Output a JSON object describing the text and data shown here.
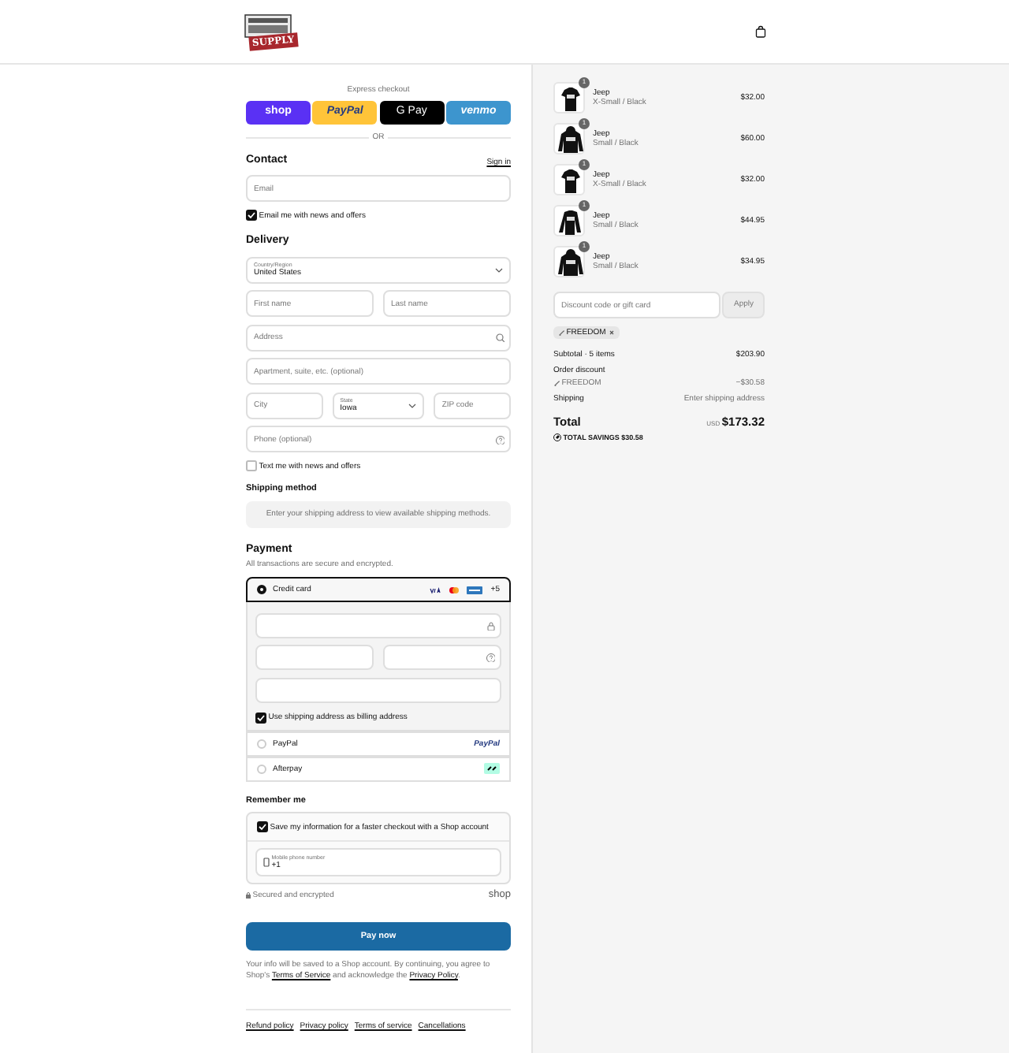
{
  "header": {
    "logo_text": "SUPPLY"
  },
  "express": {
    "title": "Express checkout",
    "buttons": [
      {
        "label": "shop",
        "kind": "shop"
      },
      {
        "label": "PayPal",
        "kind": "paypal"
      },
      {
        "label": "G Pay",
        "kind": "gpay"
      },
      {
        "label": "venmo",
        "kind": "venmo"
      }
    ],
    "separator": "OR"
  },
  "contact": {
    "heading": "Contact",
    "sign_in": "Sign in",
    "email": {
      "placeholder": "Email"
    },
    "news": {
      "label": "Email me with news and offers",
      "checked": true
    }
  },
  "delivery": {
    "heading": "Delivery",
    "rows": [
      [
        {
          "kind": "select",
          "label": "Country/Region",
          "value": "United States"
        }
      ],
      [
        {
          "kind": "text",
          "placeholder": "First name"
        },
        {
          "kind": "text",
          "placeholder": "Last name"
        }
      ],
      [
        {
          "kind": "search",
          "placeholder": "Address"
        }
      ],
      [
        {
          "kind": "text",
          "placeholder": "Apartment, suite, etc. (optional)"
        }
      ],
      [
        {
          "kind": "text",
          "placeholder": "City"
        },
        {
          "kind": "select",
          "label": "State",
          "value": "Iowa"
        },
        {
          "kind": "text",
          "placeholder": "ZIP code"
        }
      ],
      [
        {
          "kind": "help",
          "placeholder": "Phone (optional)"
        }
      ]
    ],
    "sms": {
      "label": "Text me with news and offers",
      "checked": false
    }
  },
  "shipping": {
    "heading": "Shipping method",
    "notice": "Enter your shipping address to view available shipping methods."
  },
  "payment": {
    "heading": "Payment",
    "subtitle": "All transactions are secure and encrypted.",
    "methods": [
      {
        "kind": "card",
        "label": "Credit card",
        "selected": true,
        "more": "+5"
      },
      {
        "kind": "paypal",
        "label": "PayPal",
        "selected": false,
        "logo": "PayPal"
      },
      {
        "kind": "afterpay",
        "label": "Afterpay",
        "selected": false
      }
    ],
    "card_fields": [
      [
        {
          "kind": "lock"
        }
      ],
      [
        {
          "kind": "plain"
        },
        {
          "kind": "help"
        }
      ],
      [
        {
          "kind": "plain"
        }
      ]
    ],
    "billing": {
      "label": "Use shipping address as billing address",
      "checked": true
    }
  },
  "remember": {
    "heading": "Remember me",
    "save": {
      "label": "Save my information for a faster checkout with a Shop account",
      "checked": true
    },
    "phone": {
      "label": "Mobile phone number",
      "value": "+1"
    },
    "secured": "Secured and encrypted",
    "shop_logo": "shop"
  },
  "pay_button": "Pay now",
  "legal": [
    {
      "text": "Your info will be saved to a Shop account. By continuing, you agree to Shop's ",
      "link": false
    },
    {
      "text": "Terms of Service",
      "link": true
    },
    {
      "text": " and acknowledge the ",
      "link": false
    },
    {
      "text": "Privacy Policy",
      "link": true
    },
    {
      "text": ".",
      "link": false
    }
  ],
  "footer_links": [
    "Refund policy",
    "Privacy policy",
    "Terms of service",
    "Cancellations"
  ],
  "summary": {
    "items": [
      {
        "name": "Jeep",
        "variant": "X-Small / Black",
        "price": "$32.00",
        "quantity": "1",
        "kind": "tshirt"
      },
      {
        "name": "Jeep",
        "variant": "Small / Black",
        "price": "$60.00",
        "quantity": "1",
        "kind": "hoodie"
      },
      {
        "name": "Jeep",
        "variant": "X-Small / Black",
        "price": "$32.00",
        "quantity": "1",
        "kind": "tshirt"
      },
      {
        "name": "Jeep",
        "variant": "Small / Black",
        "price": "$44.95",
        "quantity": "1",
        "kind": "longsleeve"
      },
      {
        "name": "Jeep",
        "variant": "Small / Black",
        "price": "$34.95",
        "quantity": "1",
        "kind": "hoodie"
      }
    ],
    "discount": {
      "placeholder": "Discount code or gift card",
      "button": "Apply",
      "tag": "FREEDOM"
    },
    "subtotal": {
      "label": "Subtotal · 5 items",
      "value": "$203.90"
    },
    "order_discount": {
      "label": "Order discount",
      "code": "FREEDOM",
      "value": "−$30.58"
    },
    "shipping": {
      "label": "Shipping",
      "value": "Enter shipping address"
    },
    "total": {
      "label": "Total",
      "currency": "USD",
      "value": "$173.32"
    },
    "savings": {
      "label": "TOTAL SAVINGS",
      "value": "$30.58"
    }
  }
}
